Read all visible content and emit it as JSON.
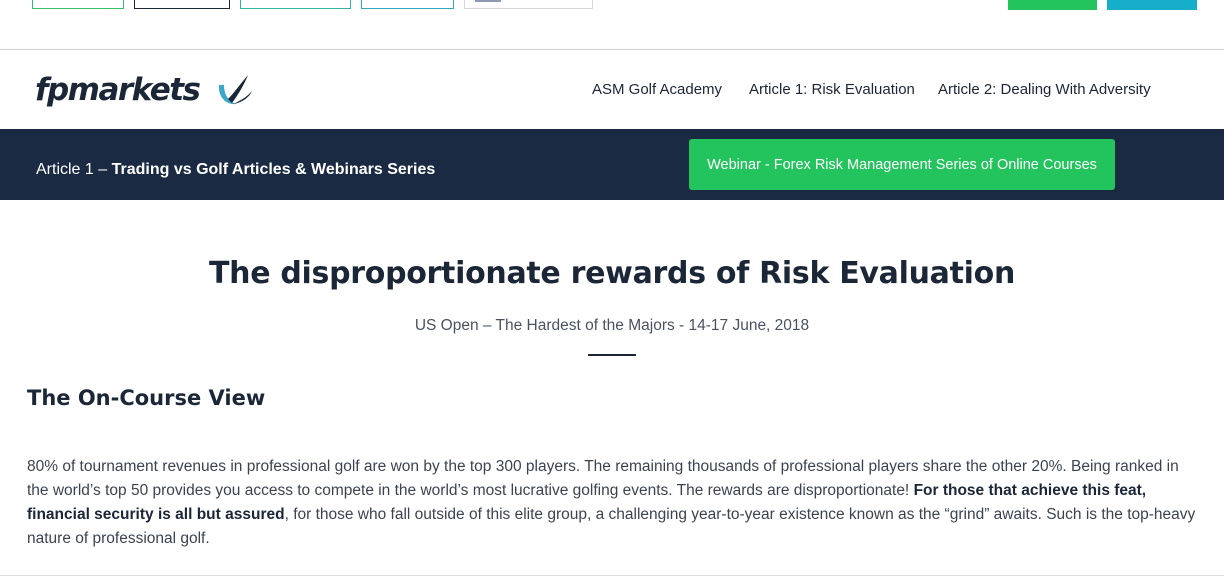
{
  "logo": {
    "text": "fpmarkets"
  },
  "nav": {
    "items": [
      {
        "label": "ASM Golf Academy"
      },
      {
        "label": "Article 1: Risk Evaluation"
      },
      {
        "label": "Article 2: Dealing With Adversity"
      }
    ]
  },
  "banner": {
    "prefix": "Article 1 – ",
    "title": "Trading vs Golf Articles & Webinars Series",
    "button_label": "Webinar - Forex Risk Management Series of Online Courses"
  },
  "article": {
    "title": "The disproportionate rewards of Risk Evaluation",
    "subtitle": "US Open – The Hardest of the Majors - 14-17 June, 2018",
    "section_heading": "The On-Course View",
    "para_part1": "80% of tournament revenues in professional golf are won by the top 300 players. The remaining thousands of professional players share the other 20%. Being ranked in the world’s top 50 provides you access to compete in the world’s most lucrative golfing events. The rewards are disproportionate! ",
    "para_bold": "For those that achieve this feat, financial security is all but assured",
    "para_part2": ", for those who fall outside of this elite group, a challenging year-to-year existence known as the “grind” awaits. Such is the top-heavy nature of professional golf."
  },
  "colors": {
    "navy": "#1b2a43",
    "green": "#23c45e",
    "cyan": "#17aecc",
    "logo_accent": "#3ba7c9"
  },
  "icons": [
    "fpmarkets-logo-icon",
    "flag-icon"
  ]
}
